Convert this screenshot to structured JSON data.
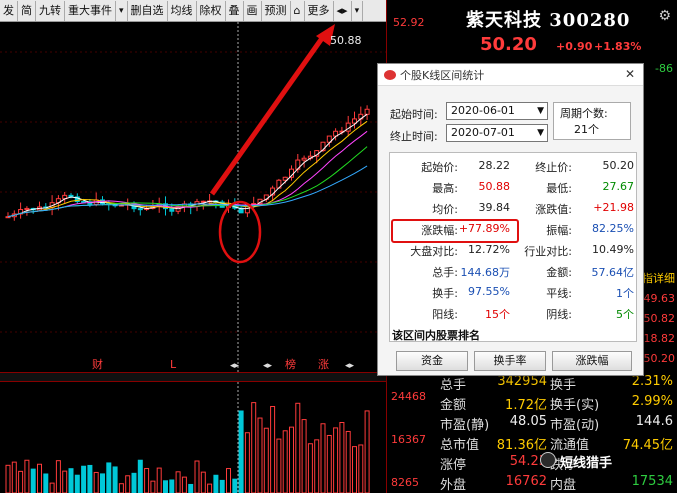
{
  "toolbar": {
    "items": [
      "发",
      "简",
      "九转",
      "重大事件",
      "▾",
      "删自选",
      "均线",
      "除权",
      "叠",
      "画",
      "预测",
      "⌂",
      "更多",
      "◂▸",
      "▾"
    ]
  },
  "stock": {
    "name": "紫天科技 300280",
    "price": "50.20",
    "change": "+0.90",
    "change_pct": "+1.83%"
  },
  "axis": {
    "top_price": "52.92",
    "high_marker": "50.88",
    "right_edge": [
      "-86",
      "49.63",
      "50.82",
      "18.82",
      "50.20"
    ],
    "vol_labels": [
      "24468",
      "16367",
      "8265"
    ],
    "side_tab": "指详细",
    "kline_marks": [
      "财",
      "L",
      "榜",
      "涨"
    ],
    "nav_marks": [
      "◂▸",
      "◂▸",
      "◂▸"
    ]
  },
  "quote": {
    "rows": [
      {
        "l": "总手",
        "v": "342954",
        "r": "换手",
        "v2": "2.31%"
      },
      {
        "l": "金额",
        "v": "1.72亿",
        "r": "换手(实)",
        "v2": "2.99%"
      },
      {
        "l": "市盈(静)",
        "v": "48.05",
        "r": "市盈(动)",
        "v2": "144.6"
      },
      {
        "l": "总市值",
        "v": "81.36亿",
        "r": "流通值",
        "v2": "74.45亿"
      },
      {
        "l": "涨停",
        "v": "54.23",
        "r": "跌停",
        "v2": ""
      },
      {
        "l": "外盘",
        "v": "16762",
        "r": "内盘",
        "v2": "17534"
      }
    ]
  },
  "dialog": {
    "title": "个股K线区间统计",
    "start_label": "起始时间:",
    "start_value": "2020-06-01",
    "end_label": "终止时间:",
    "end_value": "2020-07-01",
    "days_label": "周期个数:",
    "days_value": "21个",
    "stats": [
      {
        "l": "起始价:",
        "v": "28.22",
        "vc": "black",
        "l2": "终止价:",
        "v2": "50.20",
        "v2c": "black"
      },
      {
        "l": "最高:",
        "v": "50.88",
        "vc": "red",
        "l2": "最低:",
        "v2": "27.67",
        "v2c": "green"
      },
      {
        "l": "均价:",
        "v": "39.84",
        "vc": "black",
        "l2": "涨跌值:",
        "v2": "+21.98",
        "v2c": "red"
      },
      {
        "l": "涨跌幅:",
        "v": "+77.89%",
        "vc": "red",
        "l2": "振幅:",
        "v2": "82.25%",
        "v2c": "blue"
      },
      {
        "l": "大盘对比:",
        "v": "12.72%",
        "vc": "black",
        "l2": "行业对比:",
        "v2": "10.49%",
        "v2c": "black"
      },
      {
        "l": "总手:",
        "v": "144.68万",
        "vc": "blue",
        "l2": "金额:",
        "v2": "57.64亿",
        "v2c": "blue"
      },
      {
        "l": "换手:",
        "v": "97.55%",
        "vc": "blue",
        "l2": "平线:",
        "v2": "1个",
        "v2c": "blue"
      },
      {
        "l": "阳线:",
        "v": "15个",
        "vc": "red",
        "l2": "阴线:",
        "v2": "5个",
        "v2c": "green"
      }
    ],
    "rank_title": "该区间内股票排名",
    "btn_fund": "资金",
    "btn_turnover": "换手率",
    "btn_change": "涨跌幅"
  },
  "watermark": "短线猎手",
  "colors": {
    "up": "#ff3b3b",
    "down": "#00c8d8",
    "bg": "#000000"
  }
}
